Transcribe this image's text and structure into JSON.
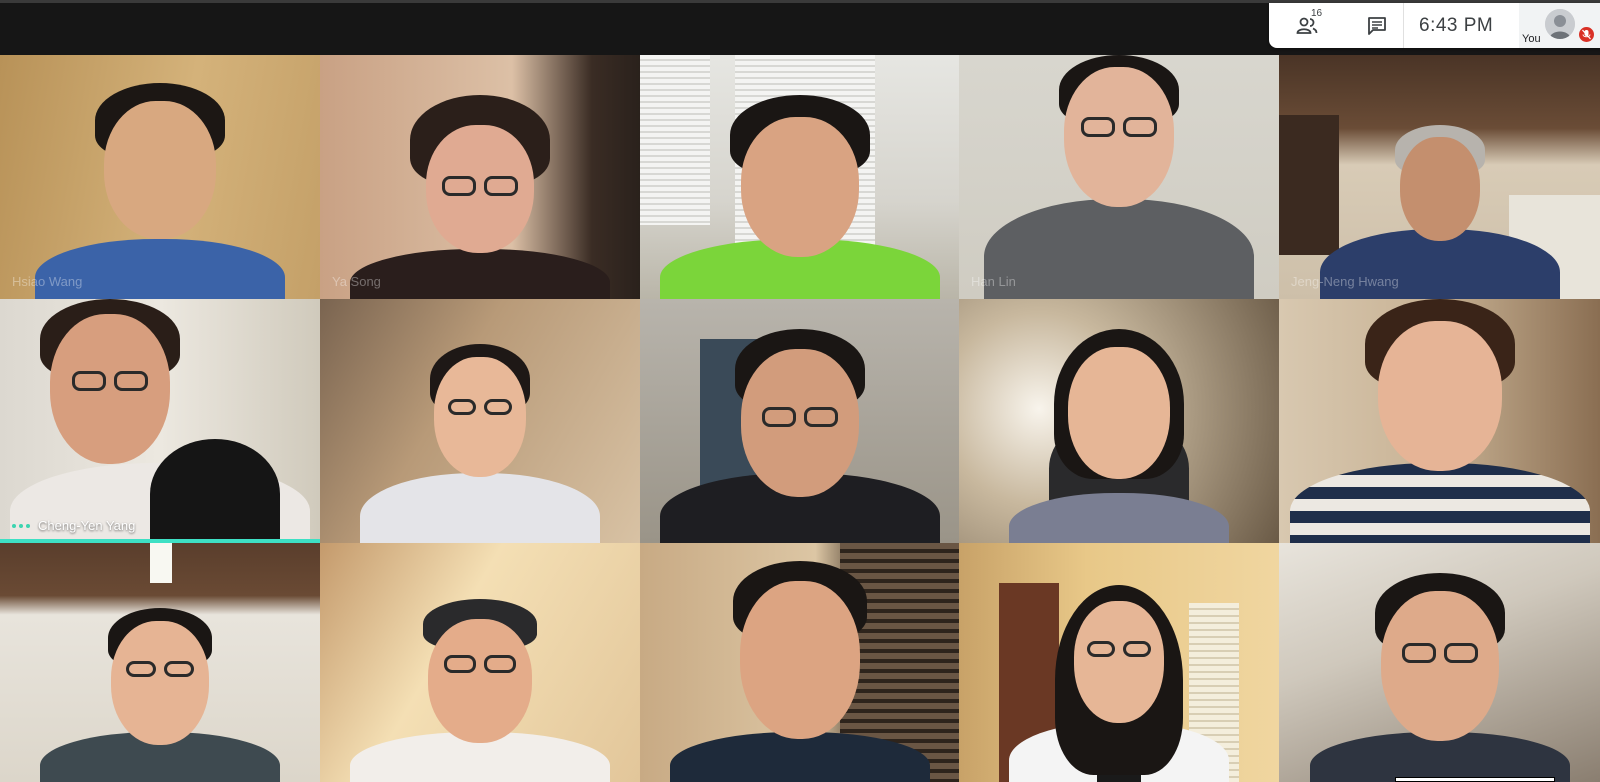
{
  "meeting": {
    "participant_count": "16",
    "clock": "6:43  PM",
    "self_label": "You"
  },
  "colors": {
    "speaking_accent": "#3ee0c4",
    "mic_off": "#d93025"
  },
  "icons": {
    "people": "people-icon",
    "chat": "chat-icon",
    "mic_off": "mic-off-icon"
  },
  "tiles": [
    {
      "name": "Hsiao Wang",
      "faint": true
    },
    {
      "name": "Ya Song",
      "faint": true
    },
    {
      "name": "",
      "faint": true
    },
    {
      "name": "Han Lin",
      "faint": true
    },
    {
      "name": "Jeng-Neng Hwang",
      "faint": true
    },
    {
      "name": "Cheng-Yen Yang",
      "faint": false,
      "speaking": true
    },
    {
      "name": "",
      "faint": true
    },
    {
      "name": "",
      "faint": true
    },
    {
      "name": "",
      "faint": true
    },
    {
      "name": "",
      "faint": true
    },
    {
      "name": "",
      "faint": true
    },
    {
      "name": "",
      "faint": true
    },
    {
      "name": "",
      "faint": true
    },
    {
      "name": "",
      "faint": true
    },
    {
      "name": "",
      "faint": true
    }
  ]
}
